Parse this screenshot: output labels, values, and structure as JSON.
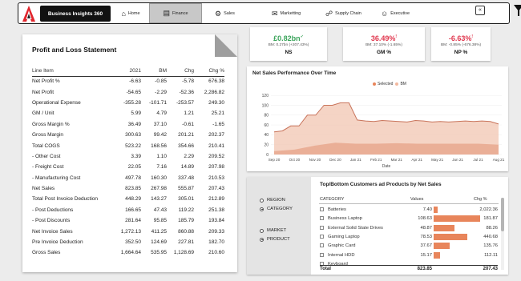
{
  "nav": {
    "brand": "Business Insights 360",
    "items": [
      {
        "label": "Home",
        "icon": "home-icon",
        "active": false
      },
      {
        "label": "Finance",
        "icon": "finance-icon",
        "active": true
      },
      {
        "label": "Sales",
        "icon": "sales-icon",
        "active": false
      },
      {
        "label": "Marketting",
        "icon": "marketing-icon",
        "active": false
      },
      {
        "label": "Supply Chain",
        "icon": "supply-chain-icon",
        "active": false
      },
      {
        "label": "Executive",
        "icon": "executive-icon",
        "active": false
      }
    ],
    "collapse": "«"
  },
  "pl": {
    "title": "Profit and Loss Statement",
    "columns": [
      "Line Item",
      "2021",
      "BM",
      "Chg",
      "Chg %"
    ],
    "rows": [
      [
        "Net Profit %",
        "-6.63",
        "-0.85",
        "-5.78",
        "676.38"
      ],
      [
        "Net Profit",
        "-54.65",
        "-2.29",
        "-52.36",
        "2,286.82"
      ],
      [
        "Operational Expense",
        "-355.28",
        "-101.71",
        "-253.57",
        "249.30"
      ],
      [
        "GM / Unit",
        "5.99",
        "4.79",
        "1.21",
        "25.21"
      ],
      [
        "Gross Margin %",
        "36.49",
        "37.10",
        "-0.61",
        "-1.65"
      ],
      [
        "Gross Margin",
        "300.63",
        "99.42",
        "201.21",
        "202.37"
      ],
      [
        "Total COGS",
        "523.22",
        "168.56",
        "354.66",
        "210.41"
      ],
      [
        "- Other Cost",
        "3.39",
        "1.10",
        "2.29",
        "209.52"
      ],
      [
        "- Freight Cost",
        "22.05",
        "7.16",
        "14.89",
        "207.98"
      ],
      [
        "- Manufacturing Cost",
        "497.78",
        "160.30",
        "337.48",
        "210.53"
      ],
      [
        "Net Sales",
        "823.85",
        "267.98",
        "555.87",
        "207.43"
      ],
      [
        "Total Post Invoice Deduction",
        "448.29",
        "143.27",
        "305.01",
        "212.89"
      ],
      [
        "- Post Deductions",
        "166.65",
        "47.43",
        "119.22",
        "251.38"
      ],
      [
        "- Post Discounts",
        "281.64",
        "95.85",
        "185.79",
        "193.84"
      ],
      [
        "Net Invoice Sales",
        "1,272.13",
        "411.25",
        "860.88",
        "209.33"
      ],
      [
        "Pre Invoice Deduction",
        "352.50",
        "124.69",
        "227.81",
        "182.70"
      ],
      [
        "Gross Sales",
        "1,664.64",
        "535.95",
        "1,128.69",
        "210.60"
      ]
    ]
  },
  "kpis": [
    {
      "value": "£0.82bn",
      "arrow": "✓",
      "sub": "BM: 0.27bn (+207.43%)",
      "label": "NS",
      "color": "#3aa45a"
    },
    {
      "value": "36.49%",
      "arrow": "!",
      "sub": "BM: 37.10% (-1.65%)",
      "label": "GM %",
      "color": "#e0364d"
    },
    {
      "value": "-6.63%",
      "arrow": "!",
      "sub": "BM: -0.85% (-676.38%)",
      "label": "NP %",
      "color": "#e0364d"
    }
  ],
  "chart_data": {
    "type": "line",
    "title": "Net Sales Performance Over Time",
    "xlabel": "Date",
    "ylabel": "",
    "legend": [
      "Selected",
      "BM"
    ],
    "legend_position": "top",
    "x": [
      "Sep 20",
      "Oct 20",
      "Nov 20",
      "Dec 20",
      "Jan 21",
      "Feb 21",
      "Mar 21",
      "Apr 21",
      "May 21",
      "Jun 21",
      "Jul 21",
      "Aug 21"
    ],
    "y_ticks": [
      0,
      20,
      40,
      60,
      80,
      100,
      120
    ],
    "ylim": [
      0,
      130
    ],
    "series": [
      {
        "name": "Selected",
        "color": "#e8855b",
        "values": [
          46,
          58,
          100,
          105,
          70,
          67,
          68,
          66,
          67,
          67,
          67,
          62
        ],
        "fine": [
          46,
          48,
          58,
          58,
          80,
          80,
          100,
          100,
          105,
          105,
          70,
          68,
          67,
          69,
          68,
          67,
          66,
          69,
          68,
          66,
          67,
          66,
          67,
          68,
          67,
          68,
          67,
          62
        ]
      },
      {
        "name": "BM",
        "color": "#f2b89f",
        "values": [
          7,
          10,
          18,
          24,
          22,
          22,
          23,
          22,
          22,
          22,
          22,
          20
        ]
      }
    ]
  },
  "bottom": {
    "title": "Top/Bottom Customers ad Products by Net Sales",
    "radios": [
      {
        "label": "REGION",
        "checked": false
      },
      {
        "label": "CATEGORY",
        "checked": true
      },
      {
        "label": "MARKET",
        "checked": false
      },
      {
        "label": "PRODUCT",
        "checked": true
      }
    ],
    "headers": {
      "category": "CATEGORY",
      "values": "Values",
      "pct": "Chg %"
    },
    "rows": [
      {
        "category": "Batteries",
        "value": "7.40",
        "pct": "2,022.36",
        "bar": 0.09
      },
      {
        "category": "Business Laptop",
        "value": "108.63",
        "pct": "181.87",
        "bar": 1.0
      },
      {
        "category": "External Solid State Drives",
        "value": "48.87",
        "pct": "88.26",
        "bar": 0.45
      },
      {
        "category": "Gaming Laptop",
        "value": "78.53",
        "pct": "440.68",
        "bar": 0.72
      },
      {
        "category": "Graphic Card",
        "value": "37.67",
        "pct": "135.76",
        "bar": 0.35
      },
      {
        "category": "Internal HDD",
        "value": "15.17",
        "pct": "112.11",
        "bar": 0.14
      },
      {
        "category": "Keyboard",
        "value": "",
        "pct": "",
        "bar": 0.5
      }
    ],
    "total_label": "Total",
    "total_value": "823.85",
    "total_pct": "207.43"
  }
}
